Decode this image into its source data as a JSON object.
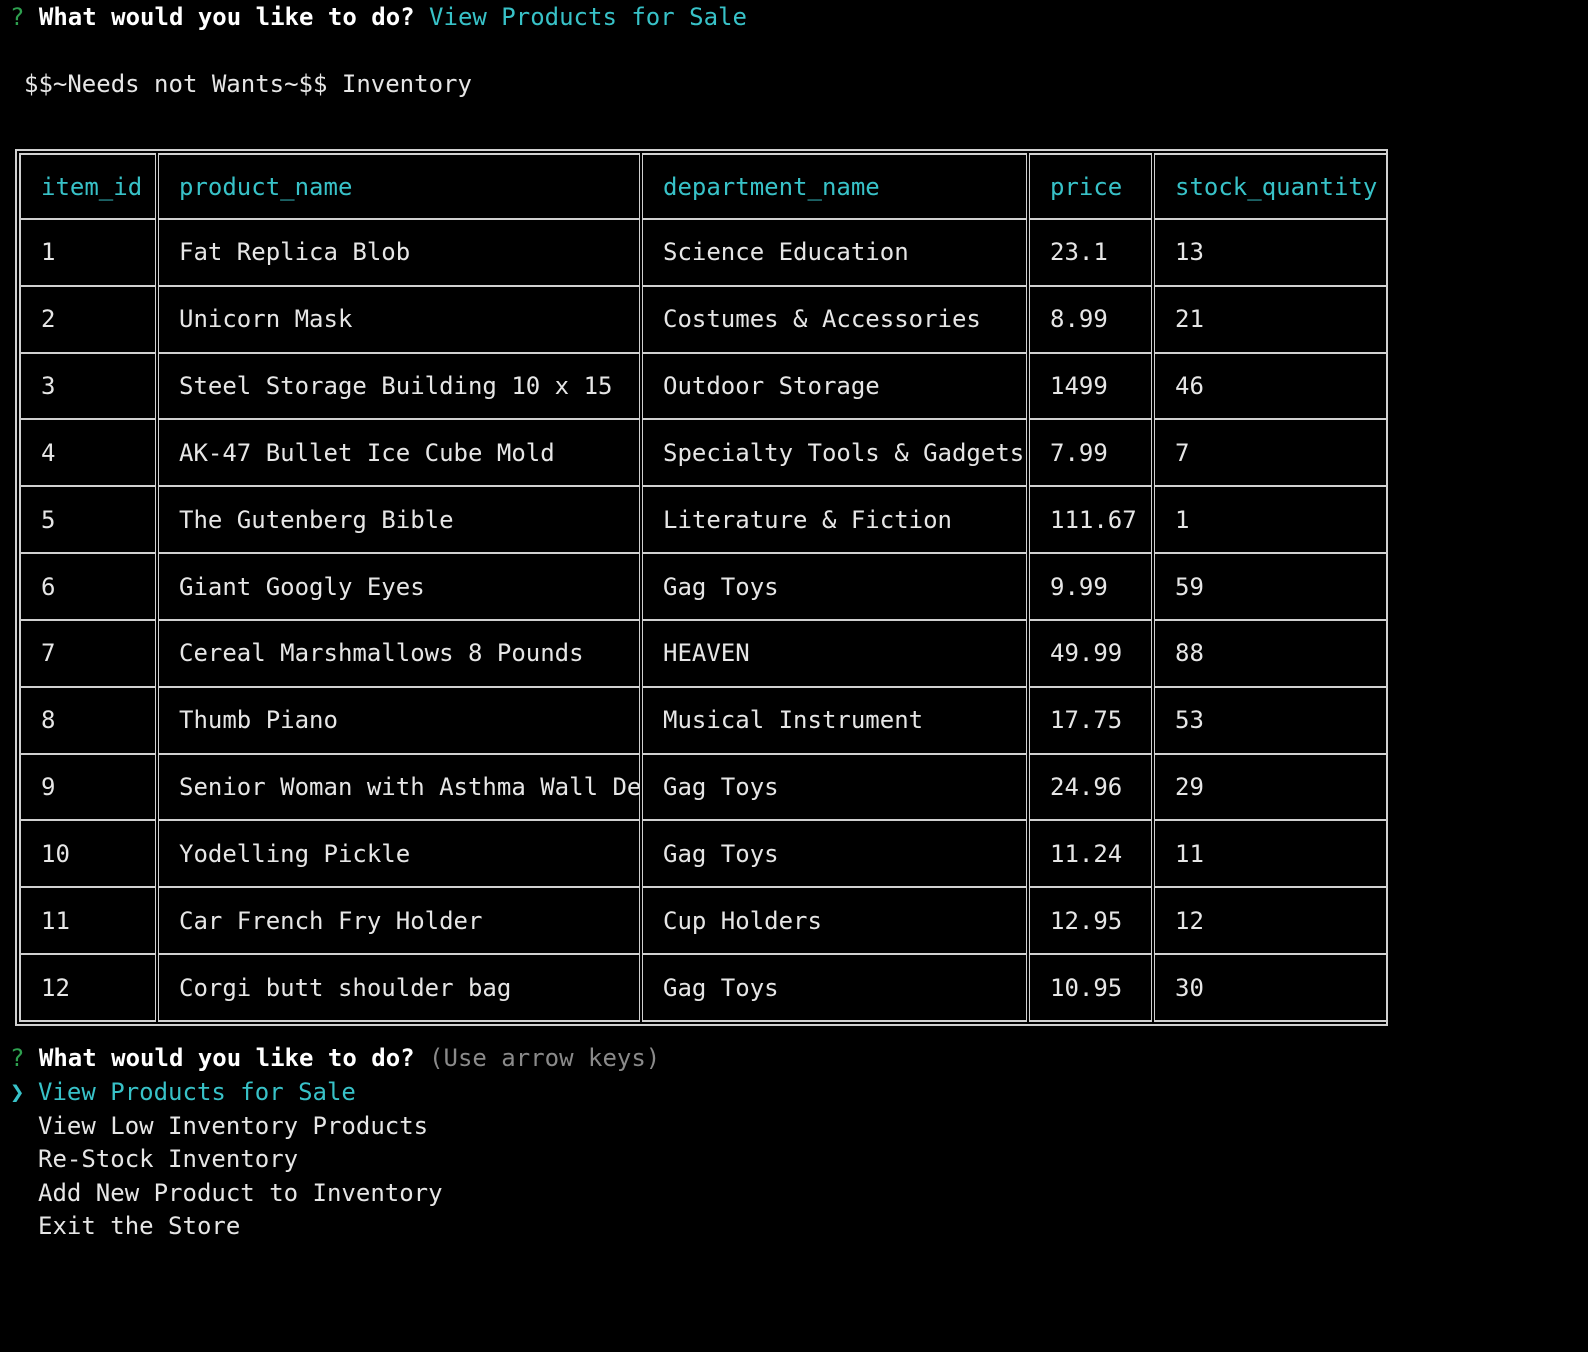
{
  "first_prompt": {
    "qmark": "?",
    "question": "What would you like to do?",
    "answer": "View Products for Sale"
  },
  "inventory_title": "$$~Needs not Wants~$$ Inventory",
  "table": {
    "headers": [
      "item_id",
      "product_name",
      "department_name",
      "price",
      "stock_quantity"
    ],
    "rows": [
      [
        "1",
        "Fat Replica Blob",
        "Science Education",
        "23.1",
        "13"
      ],
      [
        "2",
        "Unicorn Mask",
        "Costumes & Accessories",
        "8.99",
        "21"
      ],
      [
        "3",
        "Steel Storage Building 10 x 15",
        "Outdoor Storage",
        "1499",
        "46"
      ],
      [
        "4",
        "AK-47 Bullet Ice Cube Mold",
        "Specialty Tools & Gadgets",
        "7.99",
        "7"
      ],
      [
        "5",
        "The Gutenberg Bible",
        "Literature & Fiction",
        "111.67",
        "1"
      ],
      [
        "6",
        "Giant Googly Eyes",
        "Gag Toys",
        "9.99",
        "59"
      ],
      [
        "7",
        "Cereal Marshmallows 8 Pounds",
        "HEAVEN",
        "49.99",
        "88"
      ],
      [
        "8",
        "Thumb Piano",
        "Musical Instrument",
        "17.75",
        "53"
      ],
      [
        "9",
        "Senior Woman with Asthma Wall De",
        "Gag Toys",
        "24.96",
        "29"
      ],
      [
        "10",
        "Yodelling Pickle",
        "Gag Toys",
        "11.24",
        "11"
      ],
      [
        "11",
        "Car French Fry Holder",
        "Cup Holders",
        "12.95",
        "12"
      ],
      [
        "12",
        "Corgi butt shoulder bag",
        "Gag Toys",
        "10.95",
        "30"
      ]
    ]
  },
  "second_prompt": {
    "qmark": "?",
    "question": "What would you like to do?",
    "hint": "(Use arrow keys)",
    "pointer": "❯",
    "choices": [
      "View Products for Sale",
      "View Low Inventory Products",
      "Re-Stock Inventory",
      "Add New Product to Inventory",
      "Exit the Store"
    ],
    "selected_index": 0
  },
  "colors": {
    "background": "#000000",
    "text": "#e6e6e6",
    "accent_cyan": "#38c2c8",
    "qmark_green": "#2ea04f",
    "hint_gray": "#8a8a8a",
    "border": "#d0d0d0"
  }
}
